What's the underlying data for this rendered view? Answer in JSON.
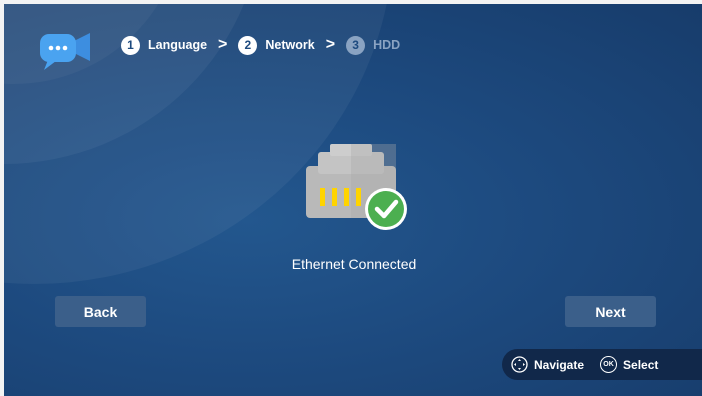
{
  "steps": [
    {
      "number": "1",
      "label": "Language"
    },
    {
      "number": "2",
      "label": "Network"
    },
    {
      "number": "3",
      "label": "HDD"
    }
  ],
  "steps_separator": ">",
  "status_text": "Ethernet Connected",
  "buttons": {
    "back": "Back",
    "next": "Next"
  },
  "hints": {
    "navigate": "Navigate",
    "ok_glyph": "OK",
    "select": "Select"
  },
  "icons": {
    "logo": "chat-camera-icon",
    "ethernet": "ethernet-port-icon",
    "check": "checkmark-icon",
    "dpad": "dpad-icon"
  },
  "colors": {
    "background": "#1d4a7f",
    "button": "#3b5f8a",
    "hint_bar": "#11284a",
    "check": "#4caf50",
    "pin": "#ffd400"
  }
}
